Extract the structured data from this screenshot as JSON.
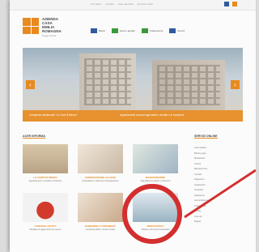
{
  "header": {
    "top_links": [
      "Chi siamo",
      "Contatti",
      "Area riservata",
      "Accesso civico"
    ],
    "logo_lines": [
      "AZIENDA",
      "CASA",
      "EMILIA",
      "ROMAGNA"
    ],
    "logo_sub": "Reggio Emilia",
    "nav_items": [
      "Bandi",
      "Gare e appalti",
      "Trasparenza",
      "Servizi"
    ]
  },
  "hero": {
    "caption_left": "Complessi residenziali \"Le Corti di Mezzo\"",
    "caption_right": "Appartamenti a prezzi agevolati in vendita e in locazione"
  },
  "main": {
    "section_title": "ACER INFORMA",
    "cards": [
      {
        "title": "LE CORTI DI MEZZO",
        "desc": "Appartamenti in vendita e locazione"
      },
      {
        "title": "ASSEGNAZIONE ALLOGGI",
        "desc": "Graduatorie e bandi per l'assegnazione"
      },
      {
        "title": "MANUTENZIONE",
        "desc": "Segnalazione guasti e interventi"
      },
      {
        "title": "CANONI E AFFITTI",
        "desc": "Modalita di pagamento dei canoni"
      },
      {
        "title": "DOMANDE E CONTRIBUTI",
        "desc": "Contributi affitto e fondo sociale"
      },
      {
        "title": "MODULISTICA",
        "desc": "Moduli e documenti scaricabili"
      }
    ]
  },
  "sidebar": {
    "title": "SERVIZI ONLINE",
    "items": [
      "Area inquilini",
      "Bandi e gare",
      "Modulistica",
      "Canoni",
      "Manutenzione",
      "Contatti",
      "Pagamenti",
      "Graduatorie",
      "Contributi",
      "Assistenza",
      "Amministrazione",
      "Trasparenza",
      "Privacy",
      "Link utili",
      "Mappa"
    ]
  },
  "colors": {
    "accent": "#e88a1e",
    "highlight": "#d32f2f"
  }
}
